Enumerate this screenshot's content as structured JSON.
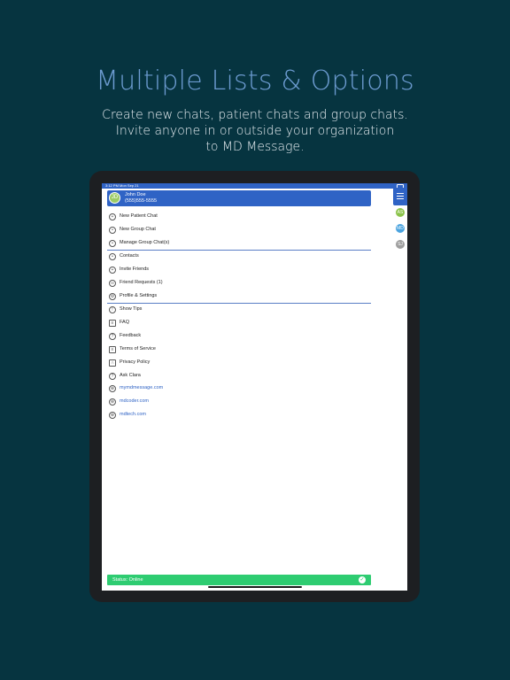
{
  "promo": {
    "title": "Multiple Lists & Options",
    "line1": "Create new chats, patient chats and group chats.",
    "line2": "Invite anyone in or outside your organization",
    "line3": "to MD Message."
  },
  "status_bar": {
    "time": "3:12 PM   Mon Sep 21"
  },
  "user": {
    "initials": "JD",
    "name": "John Doe",
    "phone": "(555)555-5555"
  },
  "side_badges": [
    "AS",
    "MD",
    "SJ"
  ],
  "menu": {
    "group1": [
      {
        "label": "New Patient Chat",
        "icon": "person-add-icon"
      },
      {
        "label": "New Group Chat",
        "icon": "group-icon"
      },
      {
        "label": "Manage Group Chat(s)",
        "icon": "group-settings-icon"
      }
    ],
    "group2": [
      {
        "label": "Contacts",
        "icon": "contacts-icon"
      },
      {
        "label": "Invite Friends",
        "icon": "invite-icon"
      },
      {
        "label": "Friend Requests (1)",
        "icon": "link-icon"
      },
      {
        "label": "Profile & Settings",
        "icon": "settings-icon"
      }
    ],
    "group3": [
      {
        "label": "Show Tips",
        "icon": "lightbulb-icon"
      },
      {
        "label": "FAQ",
        "icon": "document-icon"
      },
      {
        "label": "Feedback",
        "icon": "question-icon"
      },
      {
        "label": "Terms of Service",
        "icon": "terms-icon"
      },
      {
        "label": "Privacy Policy",
        "icon": "lock-icon"
      },
      {
        "label": "Ask Clara",
        "icon": "help-icon"
      }
    ],
    "links": [
      {
        "label": "mymdmessage.com",
        "icon": "globe-icon"
      },
      {
        "label": "mdcoder.com",
        "icon": "globe-icon"
      },
      {
        "label": "mdtech.com",
        "icon": "globe-icon"
      }
    ]
  },
  "status": {
    "label": "Status: Online"
  },
  "colors": {
    "accent": "#2f63c5",
    "online": "#2ecc71",
    "background": "#063440"
  }
}
